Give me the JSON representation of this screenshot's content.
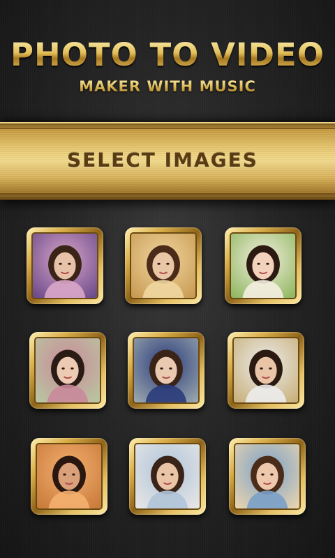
{
  "header": {
    "title": "PHOTO TO VIDEO",
    "subtitle": "MAKER WITH MUSIC"
  },
  "banner": {
    "label": "SELECT IMAGES"
  },
  "colors": {
    "gold_light": "#f4dc8e",
    "gold_dark": "#8f6418",
    "banner_text": "#5a3c14",
    "background": "#262626"
  },
  "photos": [
    {
      "name": "photo-woman-purple",
      "bg": "#6b4a8a",
      "accent": "#d9a6c8",
      "skin": "#e8c2a8",
      "hair": "#3a2418"
    },
    {
      "name": "photo-woman-bicycle",
      "bg": "#c89a52",
      "accent": "#f0d6a0",
      "skin": "#e9c6a6",
      "hair": "#4a2a18"
    },
    {
      "name": "photo-woman-straw-hat",
      "bg": "#8fb860",
      "accent": "#f4eee0",
      "skin": "#f2d2bc",
      "hair": "#2c1a12"
    },
    {
      "name": "photo-woman-camera",
      "bg": "#b9c6a0",
      "accent": "#c98a9a",
      "skin": "#edcab4",
      "hair": "#2a1c14"
    },
    {
      "name": "photo-woman-blue-top",
      "bg": "#9aa6ae",
      "accent": "#2a3c7a",
      "skin": "#e9c9b0",
      "hair": "#3a2418"
    },
    {
      "name": "photo-friends-selfie",
      "bg": "#c8b07a",
      "accent": "#ececec",
      "skin": "#e9c4a6",
      "hair": "#2a1a12"
    },
    {
      "name": "photo-couple-sunset",
      "bg": "#c87a3a",
      "accent": "#f4b070",
      "skin": "#d9a07a",
      "hair": "#2a1810"
    },
    {
      "name": "photo-friends-white",
      "bg": "#e6e6e6",
      "accent": "#b0c4d8",
      "skin": "#e9c4a6",
      "hair": "#3a2418"
    },
    {
      "name": "photo-couple-bench",
      "bg": "#e8d4b0",
      "accent": "#7aa0c8",
      "skin": "#edc8ac",
      "hair": "#4a2c18"
    }
  ]
}
